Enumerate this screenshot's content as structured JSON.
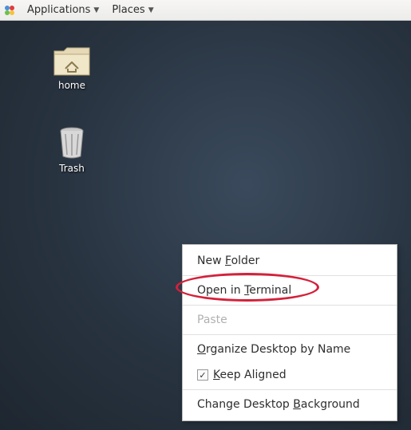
{
  "panel": {
    "applications_label": "Applications",
    "places_label": "Places"
  },
  "desktop": {
    "home_label": "home",
    "trash_label": "Trash"
  },
  "context_menu": {
    "new_folder_pre": "New ",
    "new_folder_u": "F",
    "new_folder_post": "older",
    "open_terminal_pre": "Open in ",
    "open_terminal_u": "T",
    "open_terminal_post": "erminal",
    "paste_label": "Paste",
    "organize_u": "O",
    "organize_post": "rganize Desktop by Name",
    "keep_u": "K",
    "keep_post": "eep Aligned",
    "background_pre": "Change Desktop ",
    "background_u": "B",
    "background_post": "ackground"
  }
}
